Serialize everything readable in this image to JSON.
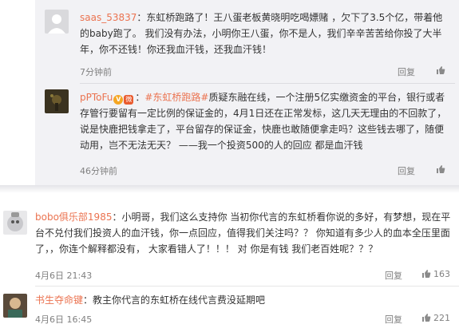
{
  "replies": [
    {
      "username": "saas_53837",
      "text": "：东虹桥跑路了！王八蛋老板黄晓明吃喝嫖赌 ，欠下了3.5个亿，带着他的baby跑了。 我们没有办法，小明你王八蛋，你不是人，我们辛辛苦苦给你投了大半年，你不还钱！你还我血汗钱，还我血汗钱！",
      "time": "7分钟前",
      "reply_label": "回复",
      "like_icon": "thumbs-up-icon"
    },
    {
      "username": "pPToFu",
      "badge": "V",
      "weibo_badge": "微",
      "topic": "#东虹桥跑路#",
      "text": "质疑东融在线，一个注册5亿实缴资金的平台，银行或者存管行要留有一定比例的保证金的，4月1日还在正常发标，这几天无理由的不回款了，说是快鹿把钱拿走了，平台留存的保证金，快鹿也敢随便拿走吗？这些钱去哪了，随便动用，岂不无法无天？ ——我一个投资500的人的回应  都是血汗钱",
      "time": "46分钟前",
      "reply_label": "回复",
      "like_icon": "thumbs-up-icon"
    }
  ],
  "comments": [
    {
      "username": "bobo俱乐部1985",
      "text": "：小明哥，我们这么支持你  当初你代言的东虹桥看你说的多好，有梦想，现在平台不兑付我们投资人的血汗钱，你一点回应，值得我们关注吗？？ 你知道有多少人的血本全压里面了，，你连个解释都没有， 大家看错人了！！！ 对  你是有钱  我们老百姓呢？？？",
      "time": "4月6日 21:43",
      "reply_label": "回复",
      "likes": "163"
    },
    {
      "username": "书生夺命键",
      "text": "：教主你代言的东虹桥在线代言费没延期吧",
      "time": "4月6日 16:45",
      "reply_label": "回复",
      "likes": "221"
    }
  ],
  "colors": {
    "username": "#eb7350",
    "panel": "#f2f2f5",
    "meta": "#808080"
  }
}
